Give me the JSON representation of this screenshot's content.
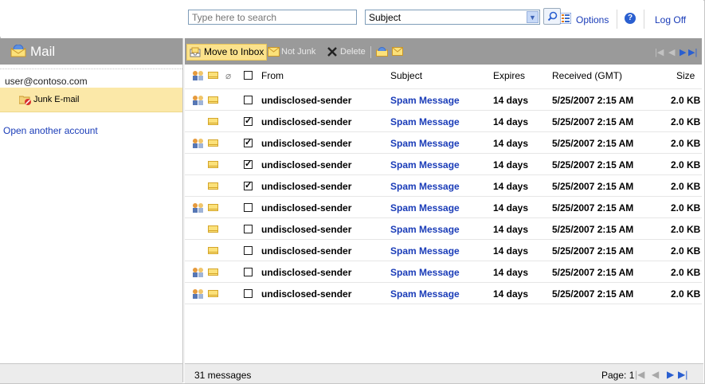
{
  "top": {
    "search_placeholder": "Type here to search",
    "search_field": "Subject",
    "options_label": "Options",
    "logoff_label": "Log Off"
  },
  "sidebar": {
    "title": "Mail",
    "account": "user@contoso.com",
    "folder": "Junk E-mail",
    "open_account": "Open another account"
  },
  "toolbar": {
    "move_label": "Move to Inbox",
    "notjunk_label": "Not Junk",
    "delete_label": "Delete"
  },
  "columns": {
    "from": "From",
    "subject": "Subject",
    "expires": "Expires",
    "received": "Received (GMT)",
    "size": "Size"
  },
  "messages": [
    {
      "from": "undisclosed-sender",
      "subject": "Spam Message",
      "expires": "14 days",
      "received": "5/25/2007 2:15 AM",
      "size": "2.0 KB",
      "checked": false,
      "people": true
    },
    {
      "from": "undisclosed-sender",
      "subject": "Spam Message",
      "expires": "14 days",
      "received": "5/25/2007 2:15 AM",
      "size": "2.0 KB",
      "checked": true,
      "people": false
    },
    {
      "from": "undisclosed-sender",
      "subject": "Spam Message",
      "expires": "14 days",
      "received": "5/25/2007 2:15 AM",
      "size": "2.0 KB",
      "checked": true,
      "people": true
    },
    {
      "from": "undisclosed-sender",
      "subject": "Spam Message",
      "expires": "14 days",
      "received": "5/25/2007 2:15 AM",
      "size": "2.0 KB",
      "checked": true,
      "people": false
    },
    {
      "from": "undisclosed-sender",
      "subject": "Spam Message",
      "expires": "14 days",
      "received": "5/25/2007 2:15 AM",
      "size": "2.0 KB",
      "checked": true,
      "people": false
    },
    {
      "from": "undisclosed-sender",
      "subject": "Spam Message",
      "expires": "14 days",
      "received": "5/25/2007 2:15 AM",
      "size": "2.0 KB",
      "checked": false,
      "people": true
    },
    {
      "from": "undisclosed-sender",
      "subject": "Spam Message",
      "expires": "14 days",
      "received": "5/25/2007 2:15 AM",
      "size": "2.0 KB",
      "checked": false,
      "people": false
    },
    {
      "from": "undisclosed-sender",
      "subject": "Spam Message",
      "expires": "14 days",
      "received": "5/25/2007 2:15 AM",
      "size": "2.0 KB",
      "checked": false,
      "people": false
    },
    {
      "from": "undisclosed-sender",
      "subject": "Spam Message",
      "expires": "14 days",
      "received": "5/25/2007 2:15 AM",
      "size": "2.0 KB",
      "checked": false,
      "people": true
    },
    {
      "from": "undisclosed-sender",
      "subject": "Spam Message",
      "expires": "14 days",
      "received": "5/25/2007 2:15 AM",
      "size": "2.0 KB",
      "checked": false,
      "people": true
    }
  ],
  "footer": {
    "count": "31 messages",
    "page_label": "Page: 1"
  },
  "icons": {
    "first": "first-page-icon",
    "prev": "prev-page-icon",
    "next": "next-page-icon",
    "last": "last-page-icon"
  }
}
